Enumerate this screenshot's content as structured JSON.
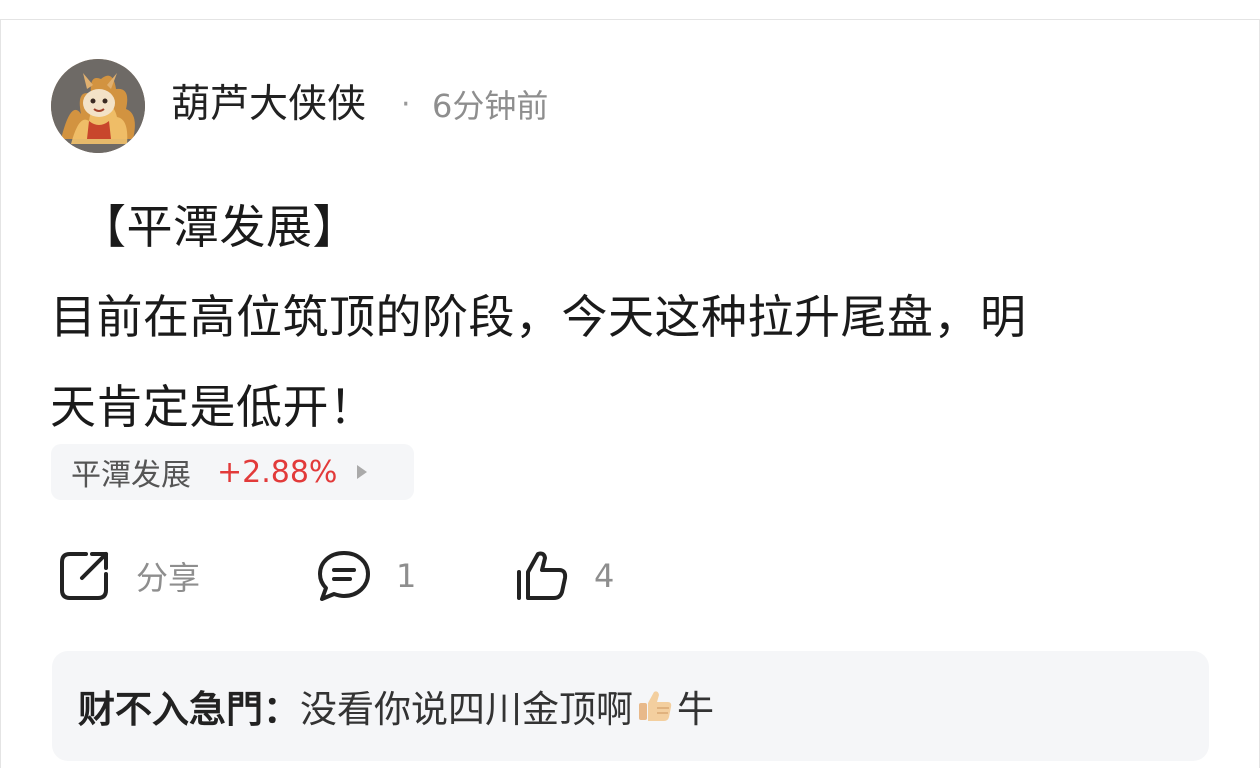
{
  "post": {
    "author": "葫芦大侠侠",
    "separator": "·",
    "time": "6分钟前",
    "title": "【平潭发展】",
    "body_line1": "目前在高位筑顶的阶段，今天这种拉升尾盘，明",
    "body_line2": "天肯定是低开！"
  },
  "stock": {
    "name": "平潭发展",
    "change": "+2.88%",
    "change_color": "#e23a3a"
  },
  "actions": {
    "share_label": "分享",
    "comment_count": "1",
    "like_count": "4",
    "share_icon": "share-icon",
    "comment_icon": "comment-bubble-icon",
    "like_icon": "thumbs-up-icon"
  },
  "comment_preview": {
    "author": "财不入急門：",
    "text_before": "没看你说四川金顶啊",
    "emoji": "thumbs-up-emoji",
    "text_after": "牛"
  }
}
